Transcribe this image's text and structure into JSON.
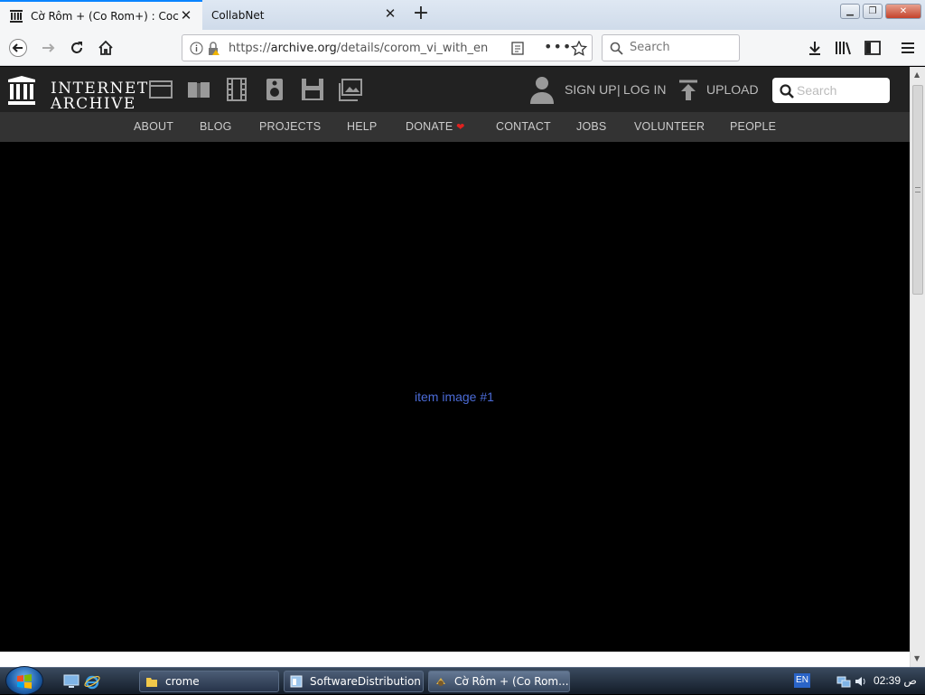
{
  "browser": {
    "tabs": [
      {
        "title": "Cờ Rôm + (Co Rom+) : Coc Coc",
        "active": true
      },
      {
        "title": "CollabNet",
        "active": false
      }
    ],
    "url": {
      "scheme": "https://",
      "host": "archive.org",
      "path": "/details/corom_vi_with_en"
    },
    "search_placeholder": "Search"
  },
  "ia": {
    "logo_line1": "INTERNET",
    "logo_line2": "ARCHIVE",
    "media_icons": [
      "web-icon",
      "texts-icon",
      "video-icon",
      "audio-icon",
      "software-icon",
      "images-icon"
    ],
    "signup_label": "SIGN UP",
    "separator": "|",
    "login_label": "LOG IN",
    "upload_label": "UPLOAD",
    "search_placeholder": "Search",
    "nav": [
      "ABOUT",
      "BLOG",
      "PROJECTS",
      "HELP",
      "DONATE",
      "CONTACT",
      "JOBS",
      "VOLUNTEER",
      "PEOPLE"
    ],
    "donate_heart_color": "#e0211f"
  },
  "content": {
    "item_image_label": "item image #1"
  },
  "taskbar": {
    "tasks": [
      "crome",
      "SoftwareDistribution",
      "Cờ Rôm + (Co Rom..."
    ],
    "lang": "EN",
    "clock": "02:39 ص"
  },
  "colors": {
    "accent": "#0a84ff",
    "link": "#4b6bd6",
    "ia_bg": "#222222",
    "ia_nav_bg": "#333333"
  }
}
